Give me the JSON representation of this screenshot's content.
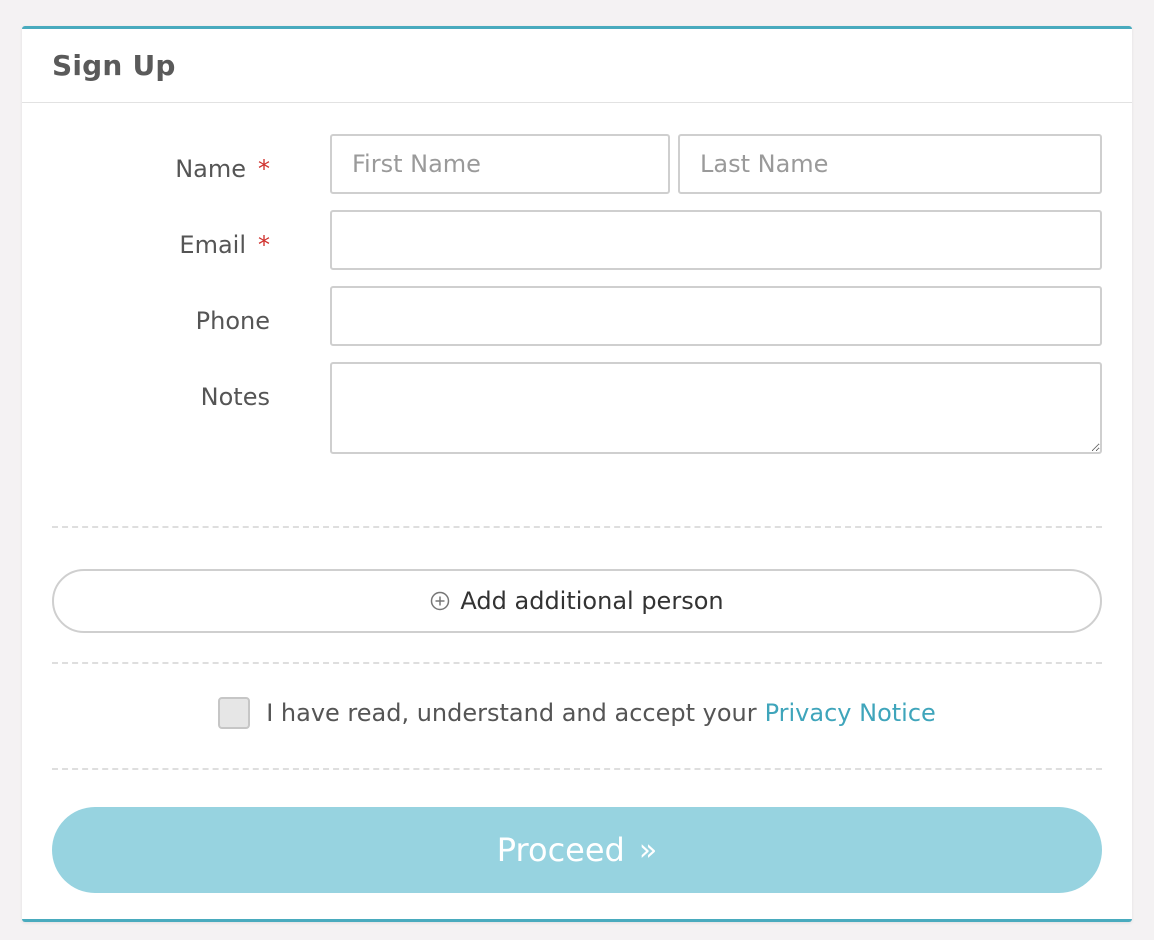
{
  "header": {
    "title": "Sign Up"
  },
  "form": {
    "name_label": "Name",
    "required_mark": "*",
    "first_name_placeholder": "First Name",
    "last_name_placeholder": "Last Name",
    "email_label": "Email",
    "phone_label": "Phone",
    "notes_label": "Notes",
    "first_name_value": "",
    "last_name_value": "",
    "email_value": "",
    "phone_value": "",
    "notes_value": ""
  },
  "actions": {
    "add_person_label": "Add additional person",
    "add_person_icon": "plus-circle-icon",
    "proceed_label": "Proceed",
    "proceed_arrow": "»"
  },
  "consent": {
    "checked": false,
    "text": "I have read, understand and accept your",
    "link_text": "Privacy Notice"
  },
  "colors": {
    "accent": "#49abbe",
    "link": "#3fa5bb",
    "proceed_bg": "#97d3e0",
    "required": "#d0312d"
  }
}
